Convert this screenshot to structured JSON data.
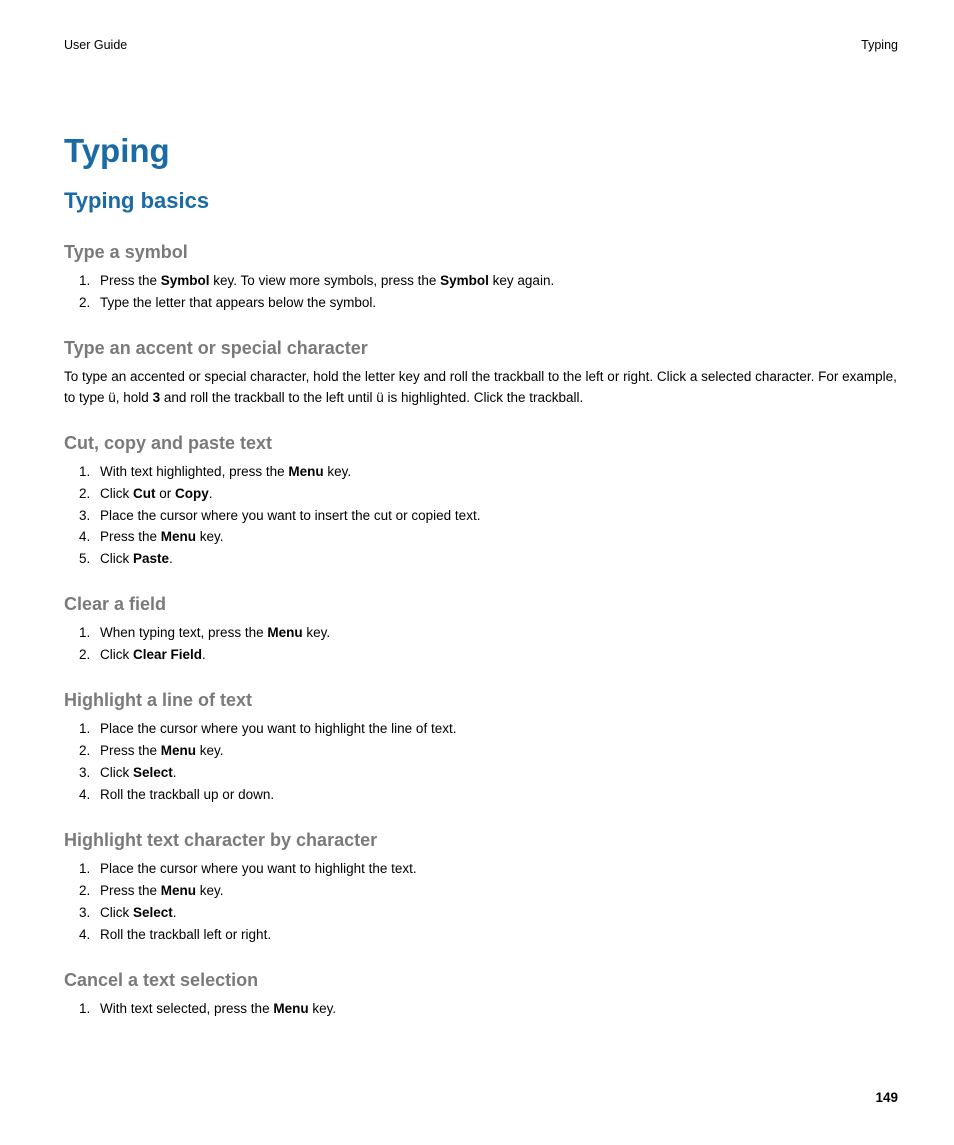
{
  "header": {
    "left": "User Guide",
    "right": "Typing"
  },
  "title": "Typing",
  "section": "Typing basics",
  "sub1": {
    "heading": "Type a symbol",
    "i1a": "Press the ",
    "i1b": "Symbol",
    "i1c": " key. To view more symbols, press the ",
    "i1d": "Symbol",
    "i1e": " key again.",
    "i2": "Type the letter that appears below the symbol."
  },
  "sub2": {
    "heading": "Type an accent or special character",
    "pa": "To type an accented or special character, hold the letter key and roll the trackball to the left or right. Click a selected character. For example, to type ü, hold ",
    "pb": "3",
    "pc": " and roll the trackball to the left until ü is highlighted. Click the trackball."
  },
  "sub3": {
    "heading": "Cut, copy and paste text",
    "i1a": "With text highlighted, press the ",
    "i1b": "Menu",
    "i1c": " key.",
    "i2a": "Click ",
    "i2b": "Cut",
    "i2c": " or ",
    "i2d": "Copy",
    "i2e": ".",
    "i3": "Place the cursor where you want to insert the cut or copied text.",
    "i4a": "Press the ",
    "i4b": "Menu",
    "i4c": " key.",
    "i5a": "Click ",
    "i5b": "Paste",
    "i5c": "."
  },
  "sub4": {
    "heading": "Clear a field",
    "i1a": "When typing text, press the ",
    "i1b": "Menu",
    "i1c": " key.",
    "i2a": "Click ",
    "i2b": "Clear Field",
    "i2c": "."
  },
  "sub5": {
    "heading": "Highlight a line of text",
    "i1": "Place the cursor where you want to highlight the line of text.",
    "i2a": "Press the ",
    "i2b": "Menu",
    "i2c": " key.",
    "i3a": "Click ",
    "i3b": "Select",
    "i3c": ".",
    "i4": "Roll the trackball up or down."
  },
  "sub6": {
    "heading": "Highlight text character by character",
    "i1": "Place the cursor where you want to highlight the text.",
    "i2a": "Press the ",
    "i2b": "Menu",
    "i2c": " key.",
    "i3a": "Click ",
    "i3b": "Select",
    "i3c": ".",
    "i4": "Roll the trackball left or right."
  },
  "sub7": {
    "heading": "Cancel a text selection",
    "i1a": "With text selected, press the ",
    "i1b": "Menu",
    "i1c": " key."
  },
  "pageNumber": "149"
}
